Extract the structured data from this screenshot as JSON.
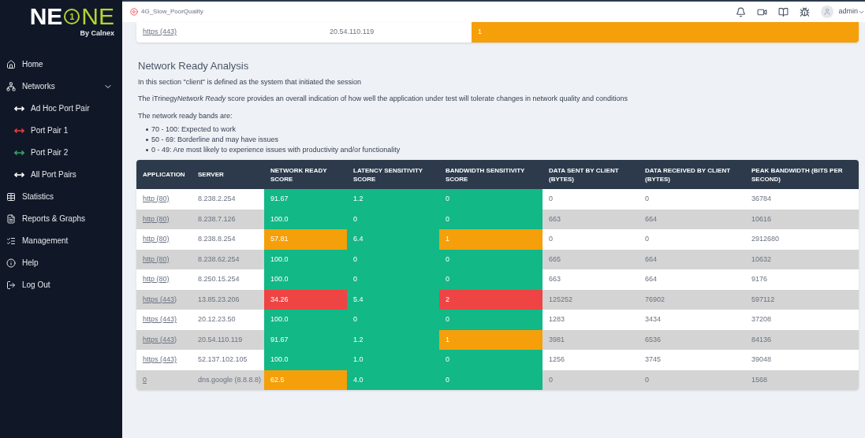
{
  "logo": {
    "left": "NE",
    "badge": "1",
    "right": "NE",
    "tagline": "By Calnex"
  },
  "sidebar": {
    "items": [
      {
        "label": "Home"
      },
      {
        "label": "Networks",
        "expanded": true,
        "children": [
          {
            "label": "Ad Hoc Port Pair",
            "color": "#ffffff"
          },
          {
            "label": "Port Pair 1",
            "color": "#e53e3e"
          },
          {
            "label": "Port Pair 2",
            "color": "#38a169"
          },
          {
            "label": "All Port Pairs",
            "color": "#ffffff"
          }
        ]
      },
      {
        "label": "Statistics"
      },
      {
        "label": "Reports & Graphs"
      },
      {
        "label": "Management"
      },
      {
        "label": "Help"
      },
      {
        "label": "Log Out"
      }
    ]
  },
  "topbar": {
    "session": "4G_Slow_PoorQuality",
    "user": "admin"
  },
  "partial_row": {
    "application": "https (443)",
    "server": "20.54.110.119",
    "value": {
      "text": "1",
      "color": "#f59f0a"
    }
  },
  "section": {
    "title": "Network Ready Analysis",
    "intro": "In this section \"client\" is defined as the system that initiated the session",
    "description": {
      "before": "The iTrinegy",
      "emphasis": "Network Ready",
      "after": " score provides an overall indication of how well the application under test will tolerate changes in network quality and conditions"
    },
    "bands_title": "The network ready bands are:",
    "bands": [
      "70 - 100: Expected to work",
      "50 - 69: Borderline and may have issues",
      "0 - 49: Are most likely to experience issues with productivity and/or functionality"
    ]
  },
  "table": {
    "columns": [
      "APPLICATION",
      "SERVER",
      "NETWORK READY SCORE",
      "LATENCY SENSITIVITY SCORE",
      "BANDWIDTH SENSITIVITY SCORE",
      "DATA SENT BY CLIENT (BYTES)",
      "DATA RECEIVED BY CLIENT (BYTES)",
      "PEAK BANDWIDTH (BITS PER SECOND)"
    ],
    "rows": [
      {
        "application": "http (80)",
        "server": "8.238.2.254",
        "ready": {
          "text": "91.67",
          "color": "#12b886"
        },
        "latency": "1.2",
        "bandwidth": {
          "text": "0",
          "color": "#12b886"
        },
        "sent": "0",
        "received": "0",
        "peak": "36784"
      },
      {
        "application": "http (80)",
        "server": "8.238.7.126",
        "ready": {
          "text": "100.0",
          "color": "#12b886"
        },
        "latency": "0",
        "bandwidth": {
          "text": "0",
          "color": "#12b886"
        },
        "sent": "663",
        "received": "664",
        "peak": "10616"
      },
      {
        "application": "http (80)",
        "server": "8.238.8.254",
        "ready": {
          "text": "57.81",
          "color": "#f59f0a"
        },
        "latency": "6.4",
        "bandwidth": {
          "text": "1",
          "color": "#f59f0a"
        },
        "sent": "0",
        "received": "0",
        "peak": "2912680"
      },
      {
        "application": "http (80)",
        "server": "8.238.62.254",
        "ready": {
          "text": "100.0",
          "color": "#12b886"
        },
        "latency": "0",
        "bandwidth": {
          "text": "0",
          "color": "#12b886"
        },
        "sent": "665",
        "received": "664",
        "peak": "10632"
      },
      {
        "application": "http (80)",
        "server": "8.250.15.254",
        "ready": {
          "text": "100.0",
          "color": "#12b886"
        },
        "latency": "0",
        "bandwidth": {
          "text": "0",
          "color": "#12b886"
        },
        "sent": "663",
        "received": "664",
        "peak": "9176"
      },
      {
        "application": "https (443)",
        "server": "13.85.23.206",
        "ready": {
          "text": "34.26",
          "color": "#ef4444"
        },
        "latency": "5.4",
        "bandwidth": {
          "text": "2",
          "color": "#ef4444"
        },
        "sent": "125252",
        "received": "76902",
        "peak": "597112"
      },
      {
        "application": "https (443)",
        "server": "20.12.23.50",
        "ready": {
          "text": "100.0",
          "color": "#12b886"
        },
        "latency": "0",
        "bandwidth": {
          "text": "0",
          "color": "#12b886"
        },
        "sent": "1283",
        "received": "3434",
        "peak": "37208"
      },
      {
        "application": "https (443)",
        "server": "20.54.110.119",
        "ready": {
          "text": "91.67",
          "color": "#12b886"
        },
        "latency": "1.2",
        "bandwidth": {
          "text": "1",
          "color": "#f59f0a"
        },
        "sent": "3981",
        "received": "6536",
        "peak": "84136"
      },
      {
        "application": "https (443)",
        "server": "52.137.102.105",
        "ready": {
          "text": "100.0",
          "color": "#12b886"
        },
        "latency": "1.0",
        "bandwidth": {
          "text": "0",
          "color": "#12b886"
        },
        "sent": "1256",
        "received": "3745",
        "peak": "39048"
      },
      {
        "application": "0",
        "server": "dns.google (8.8.8.8)",
        "ready": {
          "text": "62.5",
          "color": "#f59f0a"
        },
        "latency": "4.0",
        "bandwidth": {
          "text": "0",
          "color": "#12b886"
        },
        "sent": "0",
        "received": "0",
        "peak": "1568"
      }
    ]
  }
}
